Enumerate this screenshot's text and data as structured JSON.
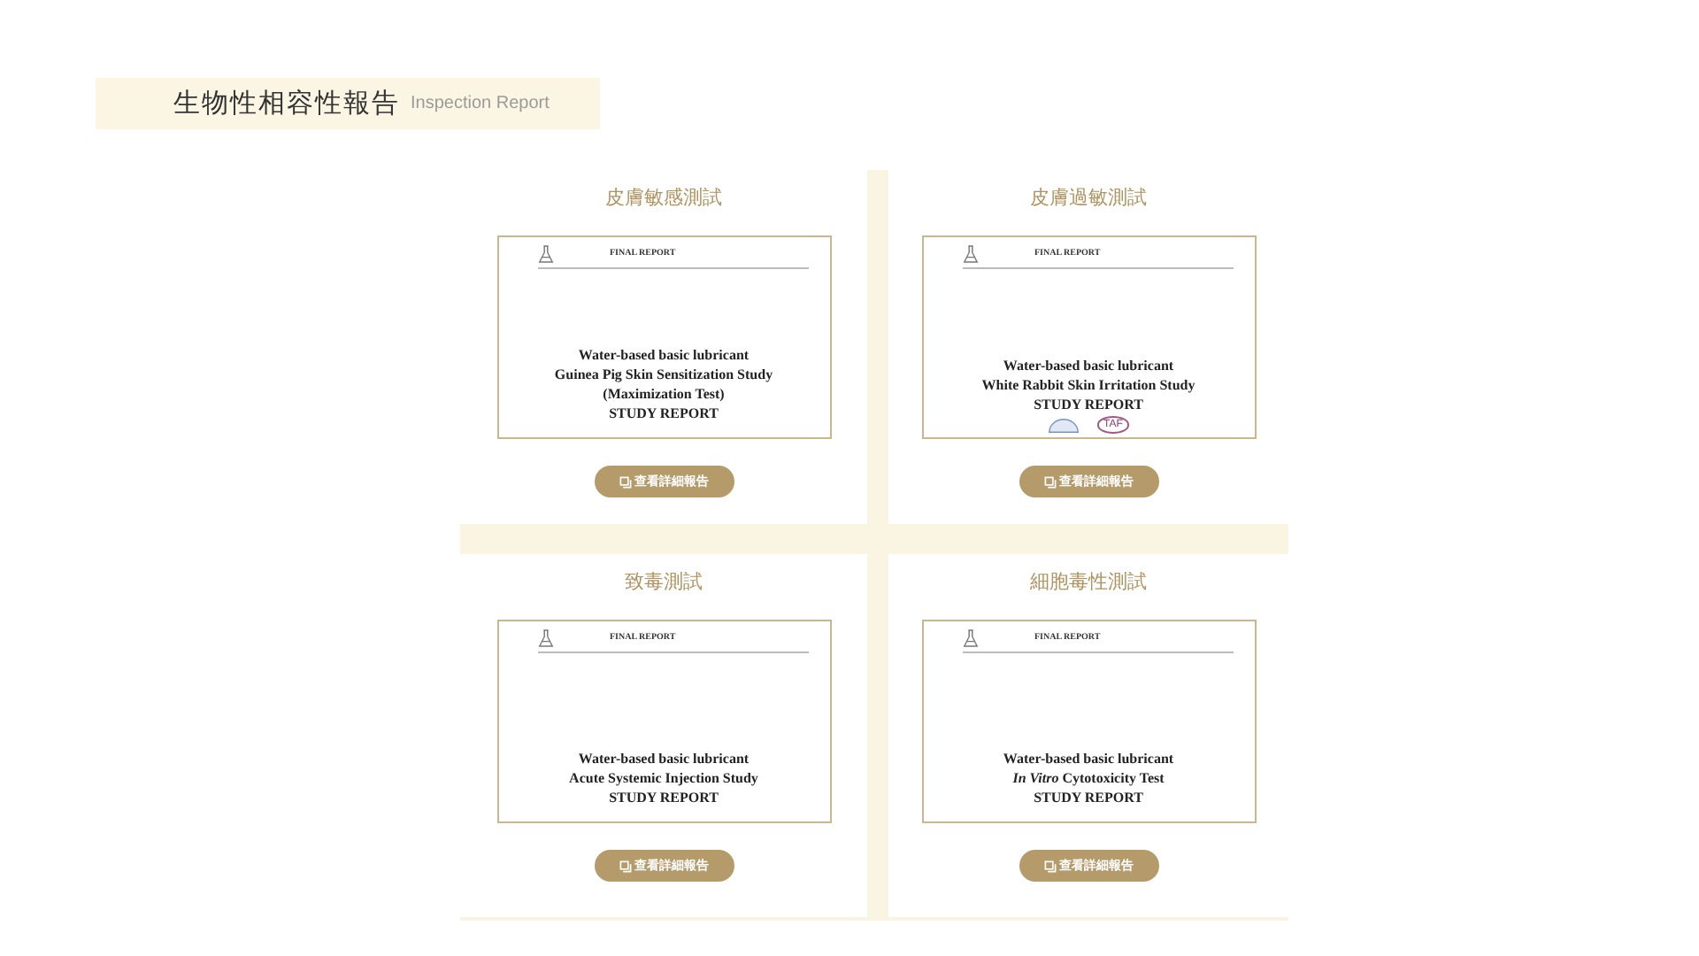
{
  "header": {
    "title": "生物性相容性報告",
    "subtitle": "Inspection Report"
  },
  "reports": [
    {
      "title": "皮膚敏感測試",
      "document": {
        "heading": "FINAL REPORT",
        "lines": [
          "Water-based basic lubricant",
          "Guinea Pig Skin Sensitization Study",
          "(Maximization Test)",
          "STUDY REPORT"
        ]
      },
      "button": "查看詳細報告"
    },
    {
      "title": "皮膚過敏測試",
      "document": {
        "heading": "FINAL REPORT",
        "lines": [
          "Water-based basic lubricant",
          "White Rabbit Skin Irritation Study",
          "STUDY REPORT"
        ],
        "marks": [
          {
            "kind": "seal"
          },
          {
            "kind": "badge",
            "label": "TAF"
          }
        ]
      },
      "button": "查看詳細報告"
    },
    {
      "title": "致毒測試",
      "document": {
        "heading": "FINAL REPORT",
        "lines": [
          "Water-based basic lubricant",
          "Acute Systemic Injection Study",
          "STUDY REPORT"
        ]
      },
      "button": "查看詳細報告"
    },
    {
      "title": "細胞毒性測試",
      "document": {
        "heading": "FINAL REPORT",
        "lines": [
          "Water-based basic lubricant",
          "*In Vitro* Cytotoxicity Test",
          "STUDY REPORT"
        ]
      },
      "button": "查看詳細報告"
    }
  ]
}
